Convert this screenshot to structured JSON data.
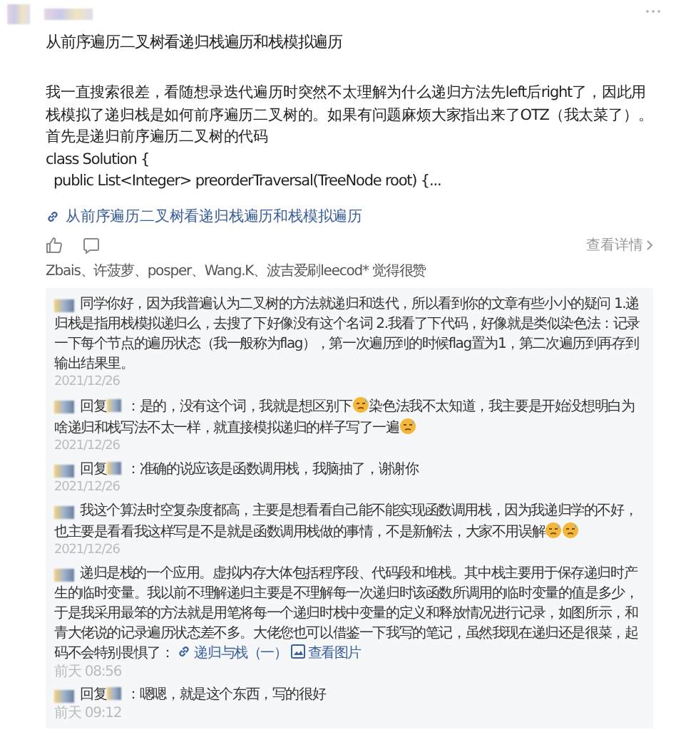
{
  "post": {
    "title": "从前序遍历二叉树看递归栈遍历和栈模拟遍历",
    "paragraphs": [
      "我一直搜索很差，看随想录迭代遍历时突然不太理解为什么递归方法先left后right了，因此用栈模拟了递归栈是如何前序遍历二叉树的。如果有问题麻烦大家指出来了OTZ（我太菜了）。",
      "首先是递归前序遍历二叉树的代码"
    ],
    "code": [
      "class Solution {",
      "  public List<Integer> preorderTraversal(TreeNode root) {..."
    ],
    "link": "从前序遍历二叉树看递归栈遍历和栈模拟遍历",
    "details": "查看详情",
    "likers": "Zbais、许菠萝、posper、Wang.K、波吉爱刷leecod* 觉得很赞"
  },
  "comments": [
    {
      "kind": "comment",
      "parts": [
        {
          "kind": "text",
          "text": "同学你好，因为我普遍认为二叉树的方法就递归和迭代，所以看到你的文章有些小小的疑问 1.递归栈是指用栈模拟递归么，去搜了下好像没有这个名词 2.我看了下代码，好像就是类似染色法：记录一下每个节点的遍历状态（我一般称为flag），第一次遍历到的时候flag置为1，第二次遍历到再存到输出结果里。"
        }
      ],
      "date": "2021/12/26"
    },
    {
      "kind": "reply",
      "reply_label": "回复",
      "parts": [
        {
          "kind": "text",
          "text": "：是的，没有这个词，我就是想区别下"
        },
        {
          "kind": "emoji"
        },
        {
          "kind": "text",
          "text": "染色法我不太知道，我主要是开始没想明白为啥递归和栈写法不太一样，就直接模拟递归的样子写了一遍"
        },
        {
          "kind": "emoji"
        }
      ],
      "date": "2021/12/26"
    },
    {
      "kind": "reply",
      "reply_label": "回复",
      "parts": [
        {
          "kind": "text",
          "text": "：准确的说应该是函数调用栈，我脑抽了，谢谢你"
        }
      ],
      "date": "2021/12/26"
    },
    {
      "kind": "comment",
      "parts": [
        {
          "kind": "text",
          "text": "我这个算法时空复杂度都高，主要是想看看自己能不能实现函数调用栈，因为我递归学的不好，也主要是看看我这样写是不是就是函数调用栈做的事情，不是新解法，大家不用误解"
        },
        {
          "kind": "emoji"
        },
        {
          "kind": "emoji"
        }
      ],
      "date": "2021/12/26"
    },
    {
      "kind": "comment",
      "parts": [
        {
          "kind": "text",
          "text": "递归是栈的一个应用。虚拟内存大体包括程序段、代码段和堆栈。其中栈主要用于保存递归时产生的临时变量。我以前不理解递归主要是不理解每一次递归时该函数所调用的临时变量的值是多少，于是我采用最笨的方法就是用笔将每一个递归时栈中变量的定义和释放情况进行记录，如图所示，和青大佬说的记录遍历状态差不多。大佬您也可以借鉴一下我写的笔记，虽然我现在递归还是很菜，起码不会特别畏惧了："
        },
        {
          "kind": "link",
          "text": "递归与栈（一）"
        },
        {
          "kind": "image",
          "text": "查看图片"
        }
      ],
      "date": "前天 08:56"
    },
    {
      "kind": "reply",
      "reply_label": "回复",
      "parts": [
        {
          "kind": "text",
          "text": "：嗯嗯，就是这个东西，写的很好"
        }
      ],
      "date": "前天 09:12"
    }
  ]
}
